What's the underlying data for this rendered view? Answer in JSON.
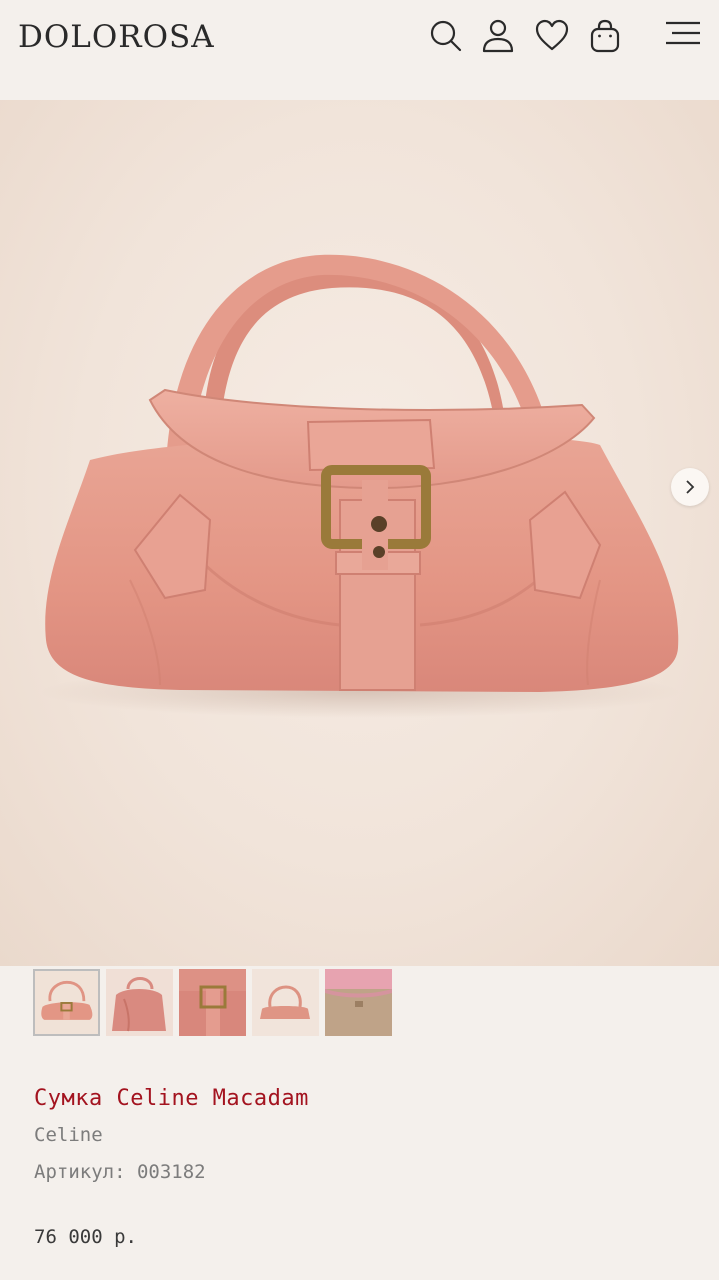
{
  "header": {
    "logo": "DOLOROSA",
    "icons": [
      "search-icon",
      "user-icon",
      "heart-icon",
      "bag-icon",
      "menu-icon"
    ]
  },
  "gallery": {
    "next_icon": "chevron-right-icon",
    "thumbnails": [
      {
        "label": "front",
        "active": true
      },
      {
        "label": "side",
        "active": false
      },
      {
        "label": "buckle-detail",
        "active": false
      },
      {
        "label": "handle",
        "active": false
      },
      {
        "label": "interior",
        "active": false
      }
    ]
  },
  "product": {
    "title": "Сумка Celine Macadam",
    "brand": "Celine",
    "sku_label": "Артикул:",
    "sku_value": "003182",
    "price": "76 000 р."
  },
  "colors": {
    "accent": "#a3131f",
    "background": "#f4f0ec",
    "bag": "#e49a8b"
  }
}
